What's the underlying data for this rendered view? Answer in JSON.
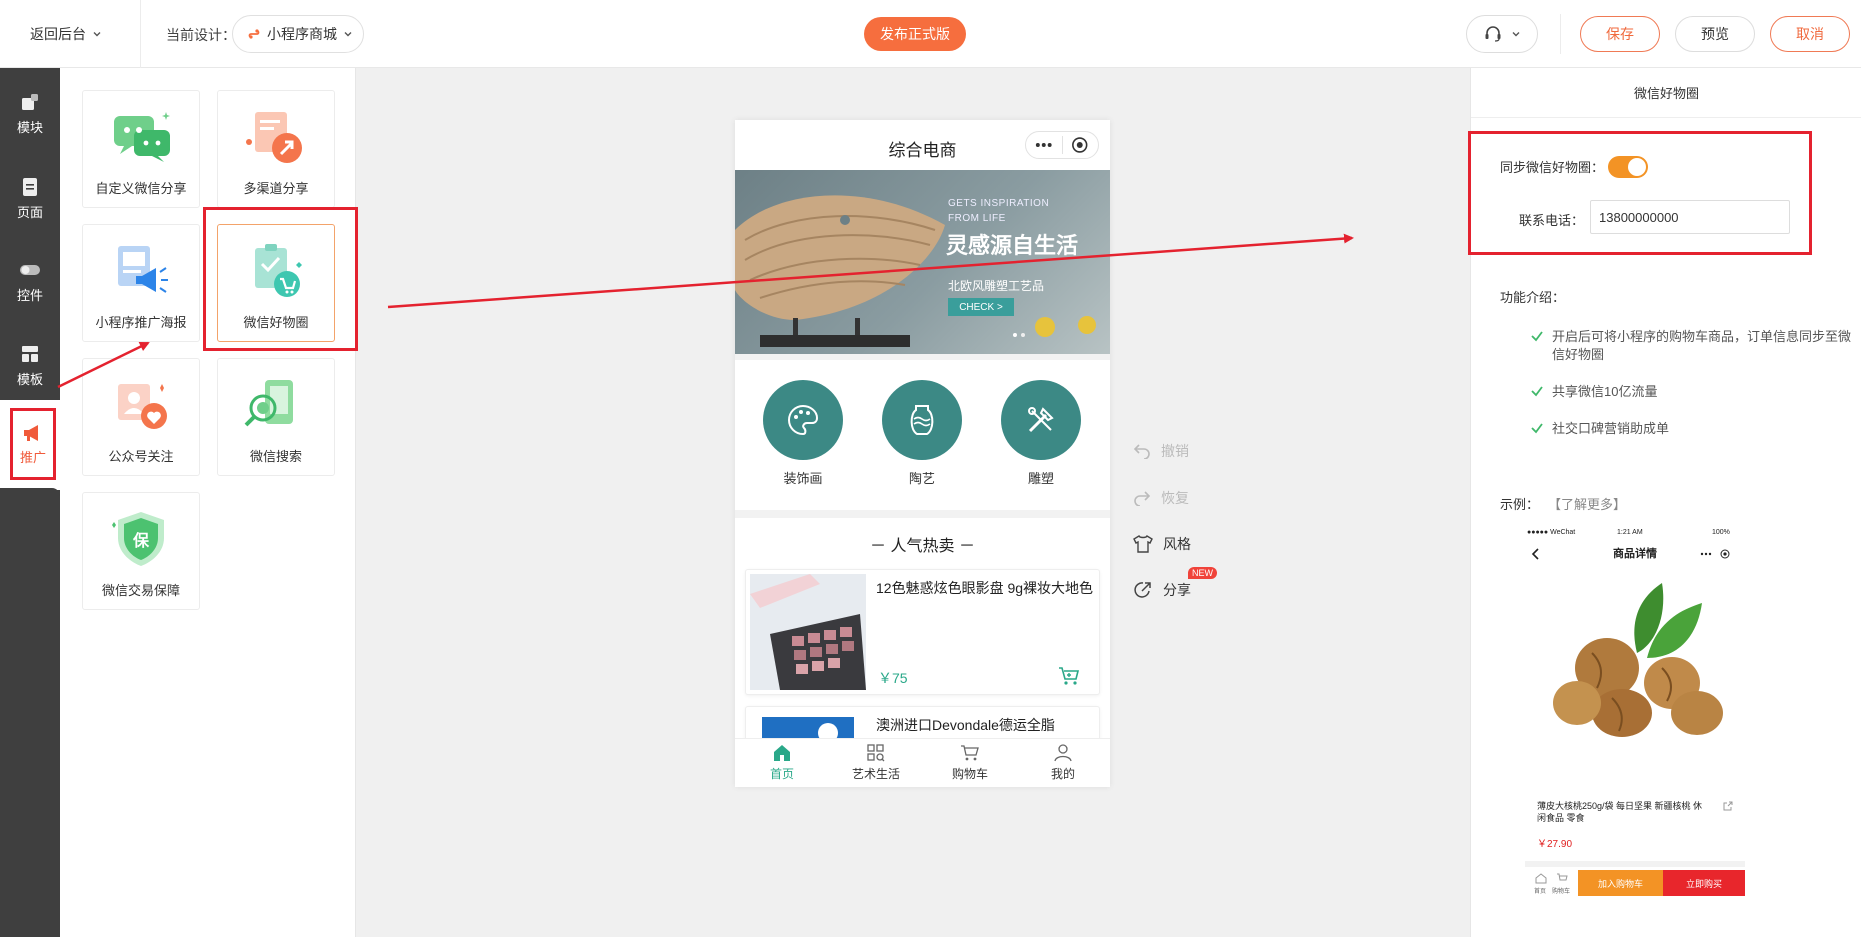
{
  "topbar": {
    "back_label": "返回后台",
    "design_label": "当前设计：",
    "design_value": "小程序商城",
    "publish_label": "发布正式版",
    "save_label": "保存",
    "preview_label": "预览",
    "cancel_label": "取消"
  },
  "rail": {
    "items": [
      {
        "label": "模块",
        "icon": "modules-icon"
      },
      {
        "label": "页面",
        "icon": "page-icon"
      },
      {
        "label": "控件",
        "icon": "toggle-icon"
      },
      {
        "label": "模板",
        "icon": "template-icon"
      },
      {
        "label": "推广",
        "icon": "megaphone-icon"
      }
    ]
  },
  "widgets": [
    {
      "label": "自定义微信分享",
      "icon": "wechat-share-icon"
    },
    {
      "label": "多渠道分享",
      "icon": "multi-share-icon"
    },
    {
      "label": "小程序推广海报",
      "icon": "poster-icon"
    },
    {
      "label": "微信好物圈",
      "icon": "wechat-goods-circle-icon"
    },
    {
      "label": "公众号关注",
      "icon": "follow-icon"
    },
    {
      "label": "微信搜索",
      "icon": "wechat-search-icon"
    },
    {
      "label": "微信交易保障",
      "icon": "shield-icon"
    }
  ],
  "shield_glyph": "保",
  "phone": {
    "title": "综合电商",
    "banner": {
      "line1": "GETS INSPIRATION",
      "line2": "FROM LIFE",
      "headline": "灵感源自生活",
      "subline": "北欧风雕塑工艺品",
      "cta": "CHECK >"
    },
    "categories": [
      "装饰画",
      "陶艺",
      "雕塑"
    ],
    "hot_title": "－ 人气热卖 －",
    "products": [
      {
        "name": "12色魅惑炫色眼影盘 9g裸妆大地色",
        "price": "￥75"
      },
      {
        "name": "澳洲进口Devondale德运全脂",
        "price": ""
      }
    ],
    "tabs": [
      "首页",
      "艺术生活",
      "购物车",
      "我的"
    ]
  },
  "side_actions": {
    "undo": "撤销",
    "redo": "恢复",
    "style": "风格",
    "share": "分享",
    "new_badge": "NEW"
  },
  "right_panel": {
    "title": "微信好物圈",
    "sync_label": "同步微信好物圈：",
    "sync_on": true,
    "phone_label": "联系电话：",
    "phone_value": "13800000000",
    "features_title": "功能介绍：",
    "features": [
      "开启后可将小程序的购物车商品，订单信息同步至微信好物圈",
      "共享微信10亿流量",
      "社交口碑营销助成单"
    ],
    "example_label": "示例：",
    "learn_more": "【了解更多】",
    "example": {
      "status_carrier": "●●●●● WeChat",
      "status_time": "1:21 AM",
      "status_battery": "100%",
      "nav_title": "商品详情",
      "product_name": "薄皮大核桃250g/袋 每日坚果 新疆核桃 休闲食品 零食",
      "price": "￥27.90",
      "tab_home": "首页",
      "tab_cart": "购物车",
      "add_cart": "加入购物车",
      "buy_now": "立即购买"
    }
  },
  "colors": {
    "accent": "#f66e3e",
    "teal": "#3c8985",
    "green_price": "#2aa889",
    "highlight_red": "#e4222f",
    "toggle_on": "#f39325"
  }
}
